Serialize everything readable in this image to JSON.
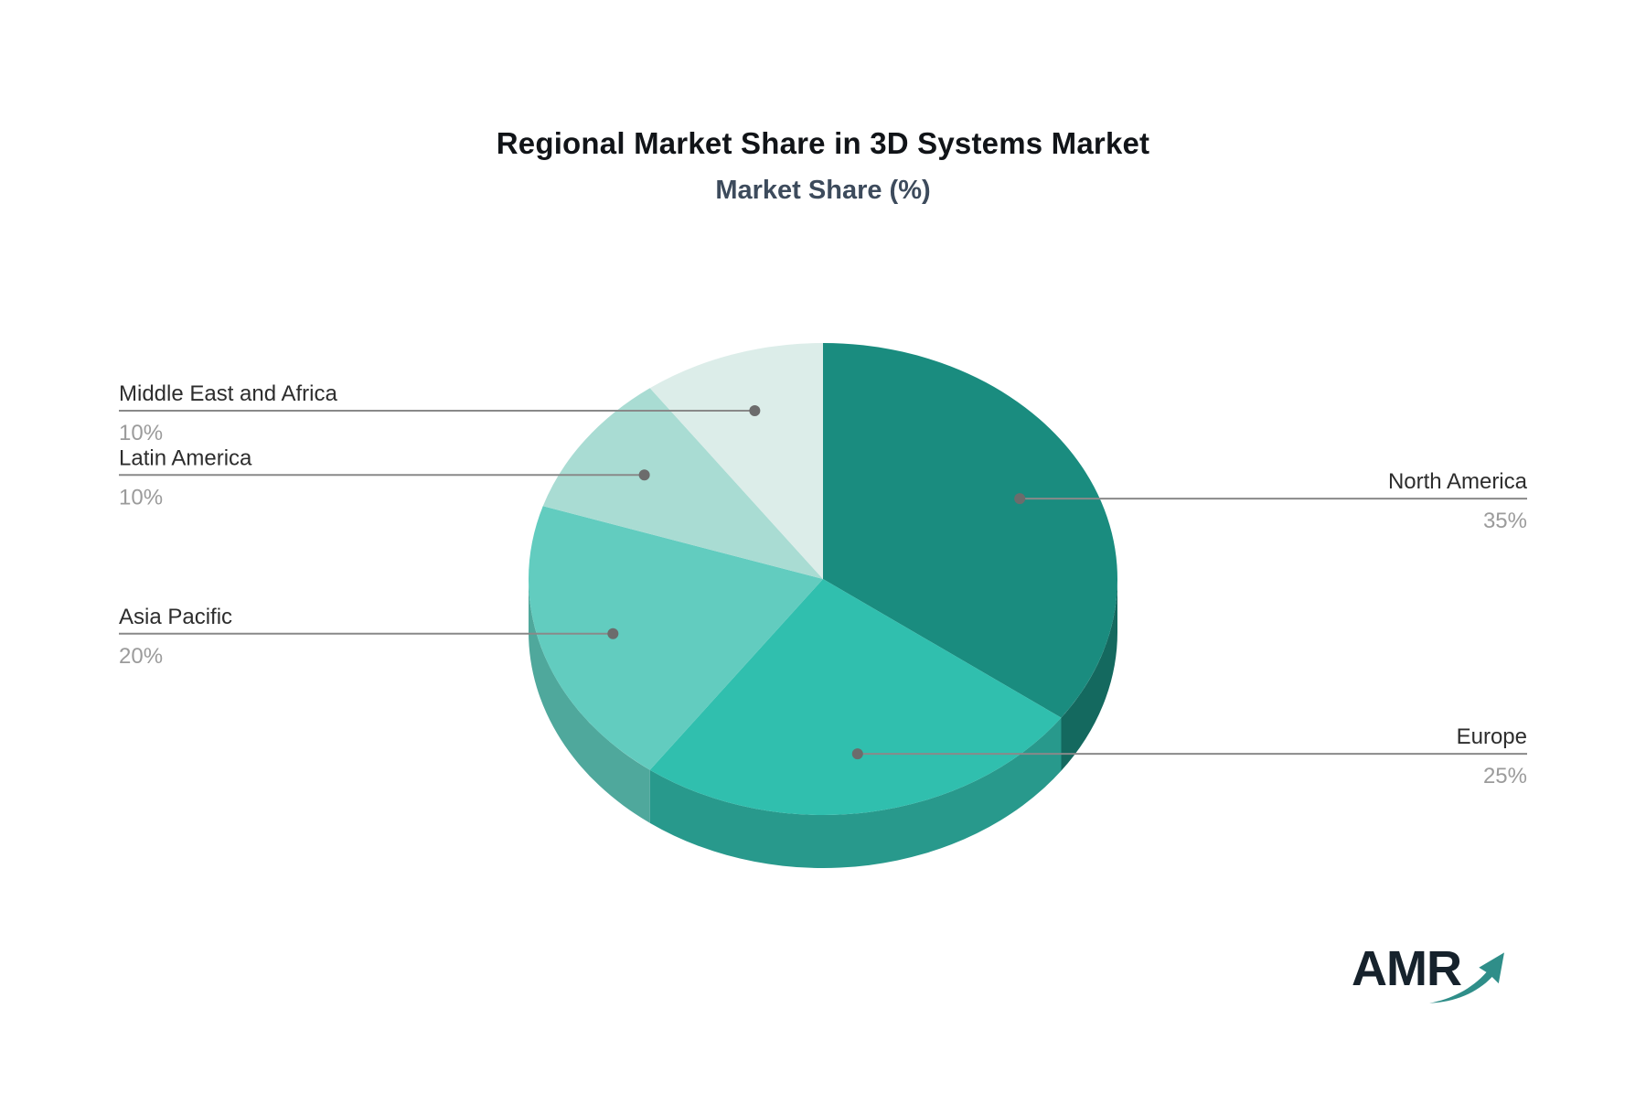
{
  "title": "Regional Market Share in 3D Systems Market",
  "subtitle": "Market Share (%)",
  "logo": {
    "text": "AMR"
  },
  "chart_data": {
    "type": "pie",
    "title": "Regional Market Share in 3D Systems Market",
    "subtitle": "Market Share (%)",
    "unit": "%",
    "effect": "3d",
    "direction": "clockwise",
    "start_angle_deg": 0,
    "legend_position": "callout-lines",
    "slices": [
      {
        "label": "North America",
        "value": 35,
        "display": "35%",
        "color": "#1A8C7F",
        "side_color": "#14695F",
        "callout_side": "right"
      },
      {
        "label": "Europe",
        "value": 25,
        "display": "25%",
        "color": "#30BFAE",
        "side_color": "#28998C",
        "callout_side": "right"
      },
      {
        "label": "Asia Pacific",
        "value": 20,
        "display": "20%",
        "color": "#62CCBF",
        "side_color": "#4FA89C",
        "callout_side": "left"
      },
      {
        "label": "Latin America",
        "value": 10,
        "display": "10%",
        "color": "#A9DCD3",
        "side_color": "#8FC4BB",
        "callout_side": "left"
      },
      {
        "label": "Middle East and Africa",
        "value": 10,
        "display": "10%",
        "color": "#DCEDE9",
        "side_color": "#BFD9D4",
        "callout_side": "left"
      }
    ],
    "style_colors": {
      "leader_line": "#898989",
      "dot": "#6c6c6c",
      "label_text": "#2d2d2d",
      "pct_text": "#9b9b9b"
    }
  }
}
